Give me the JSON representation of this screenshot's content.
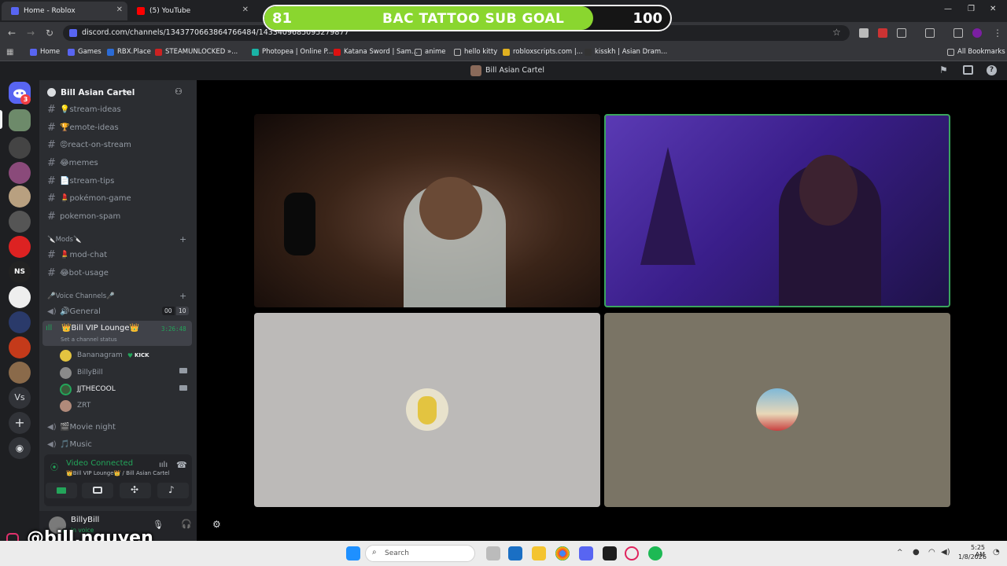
{
  "browser": {
    "tabs": [
      {
        "label": "Home - Roblox"
      },
      {
        "label": "(5) YouTube"
      }
    ],
    "url": "discord.com/channels/1343770663864766484/1433409685095279877",
    "bookmarks": [
      "Home",
      "Games",
      "RBX.Place",
      "STEAMUNLOCKED »...",
      "Photopea | Online P...",
      "Katana Sword | Sam...",
      "anime",
      "hello kitty",
      "robloxscripts.com |...",
      "kisskh | Asian Dram...",
      "All Bookmarks"
    ]
  },
  "sub_goal": {
    "current": "81",
    "title": "BAC TATTOO SUB GOAL",
    "target": "100",
    "progress": 0.81,
    "fill_color": "#8ad62f"
  },
  "discord": {
    "header_title": "Bill Asian Cartel",
    "server_badge": "3",
    "guild_name": "Bill Asian Cartel",
    "channels": [
      {
        "name": "💡stream-ideas"
      },
      {
        "name": "🏆emote-ideas"
      },
      {
        "name": "😡react-on-stream"
      },
      {
        "name": "😂memes"
      },
      {
        "name": "📄stream-tips"
      },
      {
        "name": "💄pokémon-game"
      },
      {
        "name": "pokemon-spam"
      }
    ],
    "mods_category": "🔪Mods🔪",
    "mod_channels": [
      {
        "name": "💄mod-chat"
      },
      {
        "name": "😂bot-usage"
      }
    ],
    "voice_category": "🎤Voice Channels🎤",
    "voice_general": {
      "name": "🔊General",
      "left": "00",
      "right": "10"
    },
    "vip_lounge": {
      "name": "👑Bill VIP Lounge👑",
      "timer": "3:26:48",
      "status": "Set a channel status"
    },
    "voice_users": [
      {
        "name": "Bananagram",
        "badge": "KICK"
      },
      {
        "name": "BillyBill"
      },
      {
        "name": "JJTHECOOL"
      },
      {
        "name": "ZRT"
      }
    ],
    "voice_more": [
      {
        "name": "🎬Movie night"
      },
      {
        "name": "🎵Music"
      }
    ],
    "voice_connected": {
      "title": "Video Connected",
      "sub": "👑Bill VIP Lounge👑 / Bill Asian Cartel"
    },
    "self": {
      "name": "BillyBill",
      "status": "In voice"
    },
    "instagram_handle": "@bill.nguyen"
  },
  "taskbar": {
    "search_placeholder": "Search",
    "time": "5:25 AM",
    "date": "1/8/2026"
  },
  "colors": {
    "speaking_border": "#3ba55d",
    "online_green": "#23a55a",
    "discord_blurple": "#5865f2"
  }
}
